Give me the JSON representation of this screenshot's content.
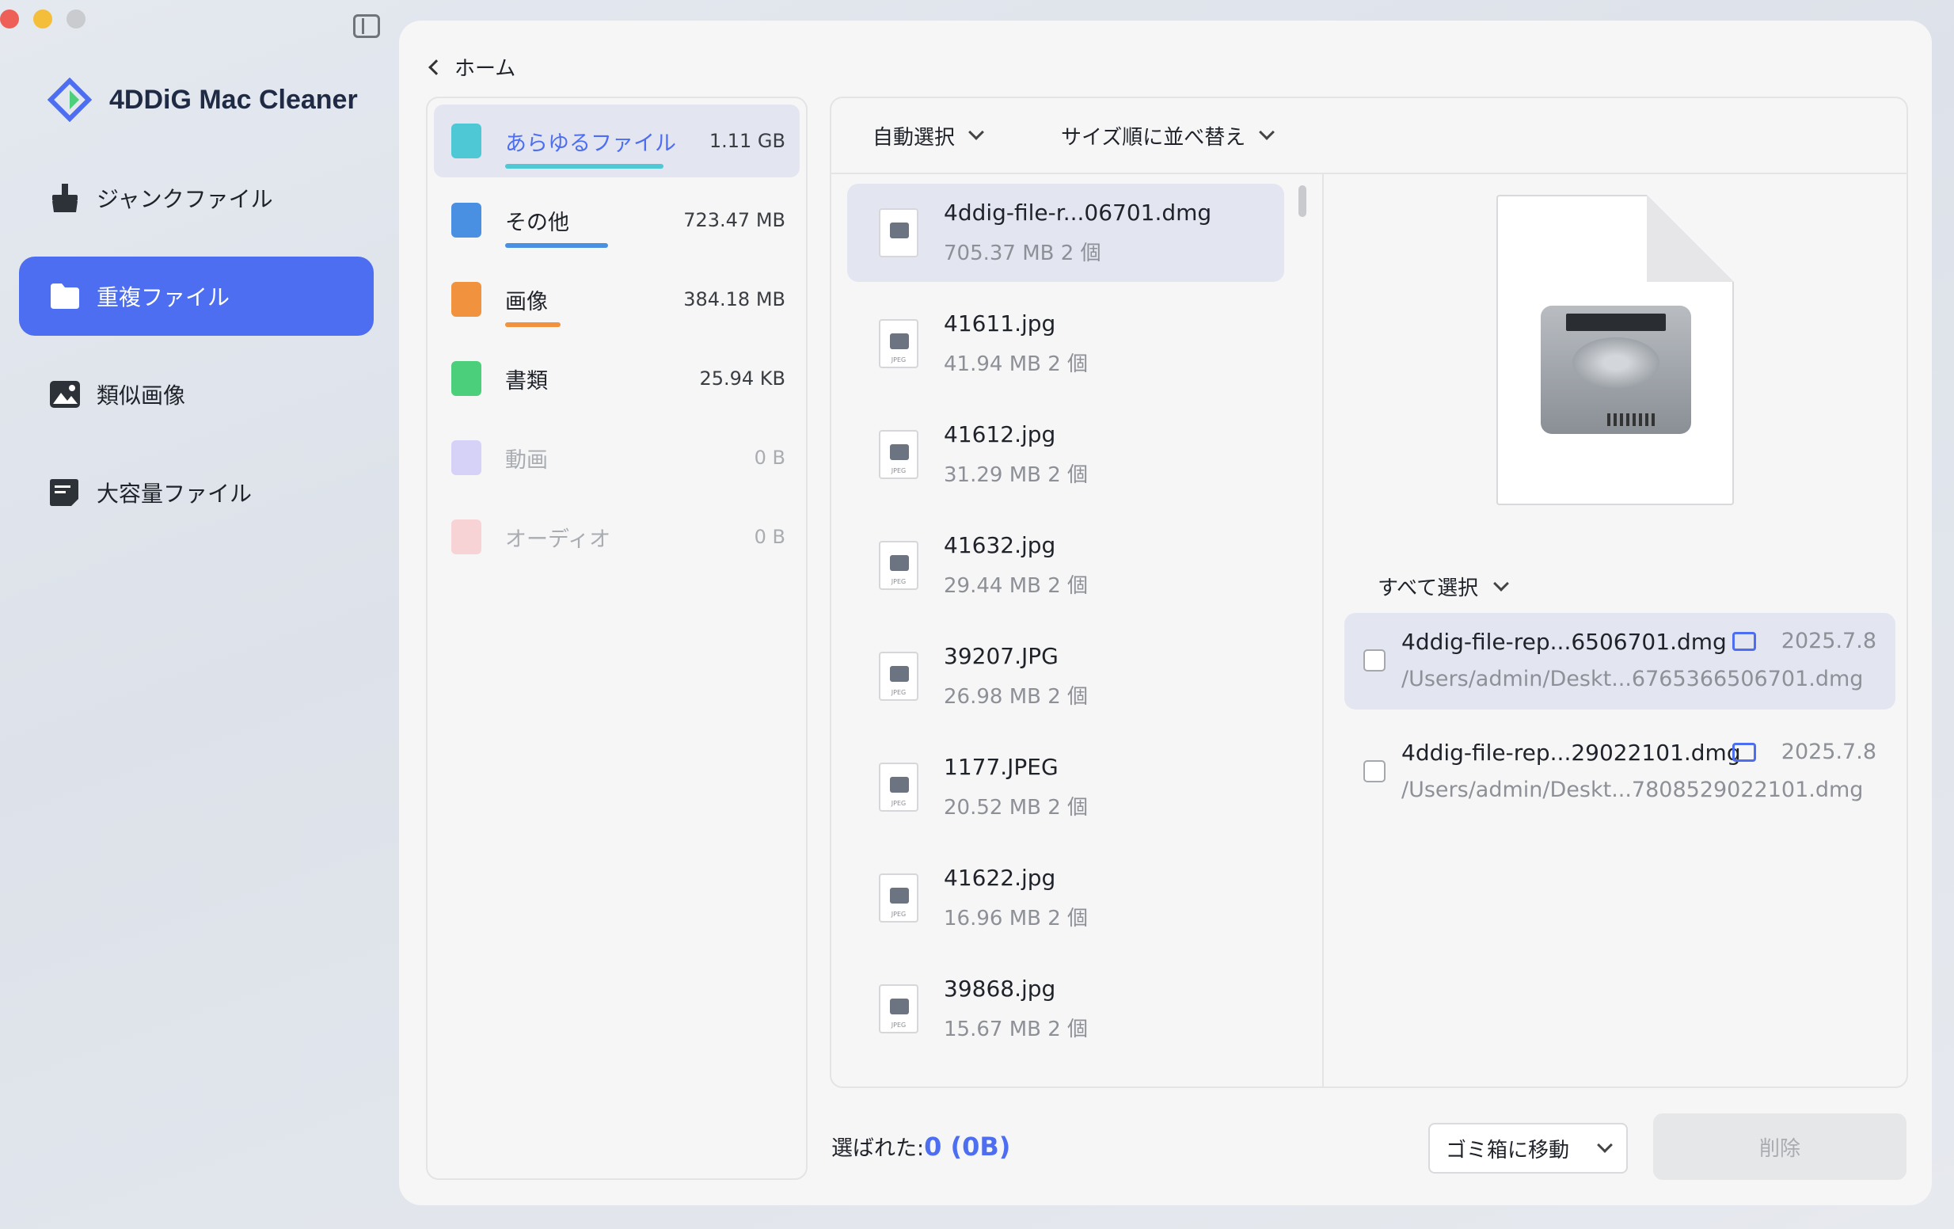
{
  "app": {
    "name": "4DDiG Mac Cleaner"
  },
  "sidebar": {
    "items": [
      {
        "label": "ジャンクファイル",
        "icon": "broom-icon",
        "active": false
      },
      {
        "label": "重複ファイル",
        "icon": "folder-icon",
        "active": true
      },
      {
        "label": "類似画像",
        "icon": "image-icon",
        "active": false
      },
      {
        "label": "大容量ファイル",
        "icon": "document-icon",
        "active": false
      }
    ]
  },
  "nav": {
    "back_label": "ホーム"
  },
  "categories": [
    {
      "name": "あらゆるファイル",
      "size": "1.11 GB",
      "color": "#4fc8d6",
      "bar": 0.62
    },
    {
      "name": "その他",
      "size": "723.47 MB",
      "color": "#4a90e2",
      "bar": 0.4
    },
    {
      "name": "画像",
      "size": "384.18 MB",
      "color": "#f0923e",
      "bar": 0.21
    },
    {
      "name": "書類",
      "size": "25.94 KB",
      "color": "#4ccf7a",
      "bar": 0
    },
    {
      "name": "動画",
      "size": "0 B",
      "color": "#b9b0f2",
      "bar": 0
    },
    {
      "name": "オーディオ",
      "size": "0 B",
      "color": "#f4b7bd",
      "bar": 0
    }
  ],
  "toolbar": {
    "auto_select": "自動選択",
    "sort": "サイズ順に並べ替え"
  },
  "files": [
    {
      "name": "4ddig-file-r...06701.dmg",
      "size": "705.37",
      "unit": "MB",
      "count": "2 個",
      "type": "dmg"
    },
    {
      "name": "41611.jpg",
      "size": "41.94",
      "unit": "MB",
      "count": "2 個",
      "type": "jpeg"
    },
    {
      "name": "41612.jpg",
      "size": "31.29",
      "unit": "MB",
      "count": "2 個",
      "type": "jpeg"
    },
    {
      "name": "41632.jpg",
      "size": "29.44",
      "unit": "MB",
      "count": "2 個",
      "type": "jpeg"
    },
    {
      "name": "39207.JPG",
      "size": "26.98",
      "unit": "MB",
      "count": "2 個",
      "type": "jpeg"
    },
    {
      "name": "1177.JPEG",
      "size": "20.52",
      "unit": "MB",
      "count": "2 個",
      "type": "jpeg"
    },
    {
      "name": "41622.jpg",
      "size": "16.96",
      "unit": "MB",
      "count": "2 個",
      "type": "jpeg"
    },
    {
      "name": "39868.jpg",
      "size": "15.67",
      "unit": "MB",
      "count": "2 個",
      "type": "jpeg"
    }
  ],
  "detail": {
    "select_all": "すべて選択",
    "duplicates": [
      {
        "name": "4ddig-file-rep...6506701.dmg",
        "date": "2025.7.8",
        "path": "/Users/admin/Deskt...6765366506701.dmg"
      },
      {
        "name": "4ddig-file-rep...29022101.dmg",
        "date": "2025.7.8",
        "path": "/Users/admin/Deskt...7808529022101.dmg"
      }
    ]
  },
  "footer": {
    "selected_label": "選ばれた:",
    "selected_value": "0 (0B)",
    "trash_option": "ゴミ箱に移動",
    "delete_label": "削除"
  },
  "colors": {
    "accent": "#4d6ef0"
  }
}
